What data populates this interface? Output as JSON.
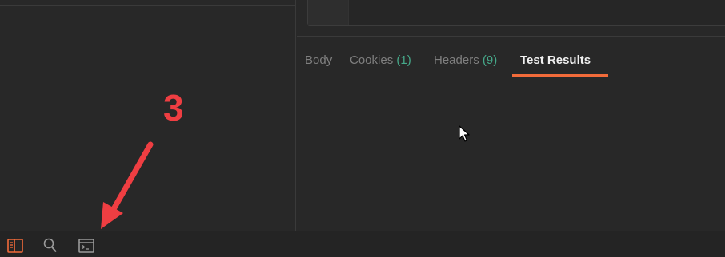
{
  "response_tabs": [
    {
      "label": "Body",
      "count": ""
    },
    {
      "label": "Cookies",
      "count": "(1)"
    },
    {
      "label": "Headers",
      "count": "(9)"
    },
    {
      "label": "Test Results",
      "count": ""
    }
  ],
  "active_tab": "Test Results",
  "annotation": {
    "number": "3",
    "color": "#ef3e42"
  },
  "statusbar": {
    "icons": [
      "toggle-sidebar-icon",
      "search-icon",
      "console-icon"
    ],
    "accent_color": "#f26b3a"
  },
  "colors": {
    "background": "#282828",
    "tab_active_underline": "#f26b3a",
    "count_color": "#46a98a"
  }
}
